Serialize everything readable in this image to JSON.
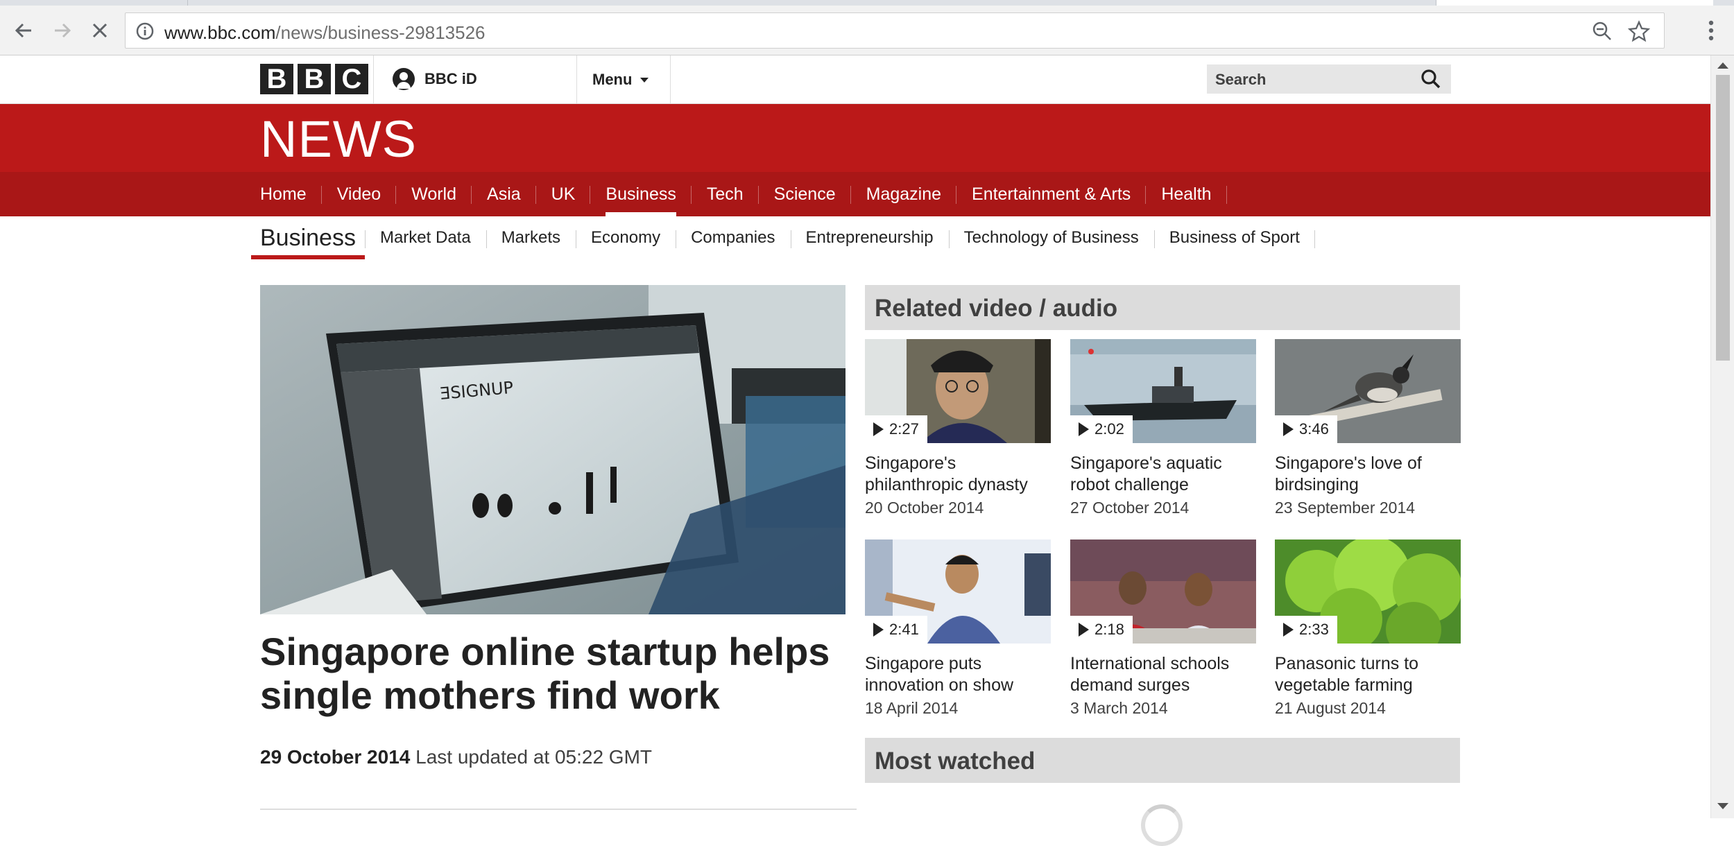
{
  "browser": {
    "url_host": "www.bbc.com",
    "url_path": "/news/business-29813526"
  },
  "masthead": {
    "logo_letters": [
      "B",
      "B",
      "C"
    ],
    "bbc_id_label": "BBC iD",
    "menu_label": "Menu",
    "search_placeholder": "Search"
  },
  "brand": {
    "section_title": "NEWS",
    "accent_color": "#bb1919"
  },
  "nav": {
    "items": [
      "Home",
      "Video",
      "World",
      "Asia",
      "UK",
      "Business",
      "Tech",
      "Science",
      "Magazine",
      "Entertainment & Arts",
      "Health"
    ],
    "active": "Business"
  },
  "subnav": {
    "title": "Business",
    "items": [
      "Market Data",
      "Markets",
      "Economy",
      "Companies",
      "Entrepreneurship",
      "Technology of Business",
      "Business of Sport"
    ]
  },
  "story": {
    "headline": "Singapore online startup helps single mothers find work",
    "date": "29 October 2014",
    "updated": "Last updated at 05:22 GMT"
  },
  "related": {
    "heading": "Related video / audio",
    "videos": [
      {
        "duration": "2:27",
        "title": "Singapore's philanthropic dynasty",
        "date": "20 October 2014"
      },
      {
        "duration": "2:02",
        "title": "Singapore's aquatic robot challenge",
        "date": "27 October 2014"
      },
      {
        "duration": "3:46",
        "title": "Singapore's love of birdsinging",
        "date": "23 September 2014"
      },
      {
        "duration": "2:41",
        "title": "Singapore puts innovation on show",
        "date": "18 April 2014"
      },
      {
        "duration": "2:18",
        "title": "International schools demand surges",
        "date": "3 March 2014"
      },
      {
        "duration": "2:33",
        "title": "Panasonic turns to vegetable farming",
        "date": "21 August 2014"
      }
    ]
  },
  "most_watched": {
    "heading": "Most watched"
  }
}
